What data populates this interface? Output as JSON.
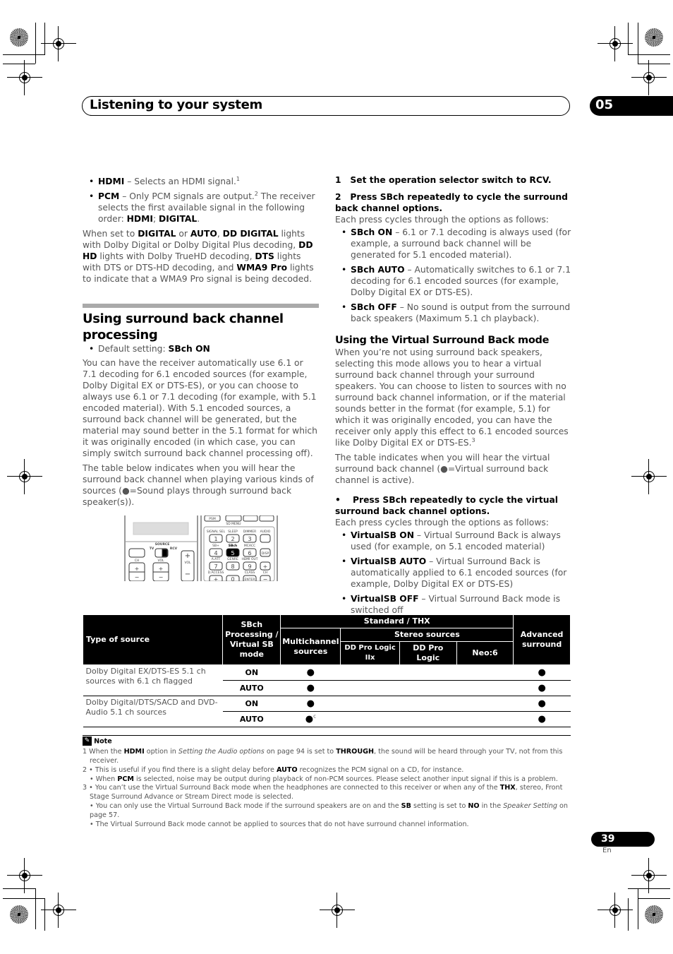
{
  "header": {
    "title": "Listening to your system",
    "chapter": "05"
  },
  "left_column": {
    "bullets": [
      {
        "term": "HDMI",
        "text": " – Selects an HDMI signal.",
        "sup": "1"
      },
      {
        "term": "PCM",
        "text": " – Only PCM signals are output.",
        "sup": "2",
        "text2": " The receiver selects the first available signal in the following order: ",
        "order_a": "HDMI",
        "sep": "; ",
        "order_b": "DIGITAL",
        "end": "."
      }
    ],
    "indicator_para": {
      "t1": "When set to ",
      "b1": "DIGITAL",
      "t2": " or ",
      "b2": "AUTO",
      "t3": ", ",
      "b3": "DD DIGITAL",
      "t4": " lights with Dolby Digital or Dolby Digital Plus decoding, ",
      "b4": "DD HD",
      "t5": " lights with Dolby TrueHD decoding, ",
      "b5": "DTS",
      "t6": " lights with DTS or DTS-HD decoding, and ",
      "b6": "WMA9 Pro",
      "t7": " lights to indicate that a WMA9 Pro signal is being decoded."
    },
    "section_title": "Using surround back channel processing",
    "default_setting_label": "Default setting: ",
    "default_setting_value": "SBch ON",
    "para1": "You can have the receiver automatically use 6.1 or 7.1 decoding for 6.1 encoded sources (for example, Dolby Digital EX or DTS-ES), or you can choose to always use 6.1 or 7.1 decoding (for example, with 5.1 encoded material). With 5.1 encoded sources, a surround back channel will be generated, but the material may sound better in the 5.1 format for which it was originally encoded (in which case, you can simply switch surround back channel processing off).",
    "para2": "The table below indicates when you will hear the surround back channel when playing various kinds of sources (●=Sound plays through surround back speaker(s)).",
    "remote": {
      "source_label": "SOURCE",
      "tv_label": "TV",
      "rcv_label": "RCV",
      "ch_label": "CH",
      "vol_label": "VOL",
      "psm_label": "PSM",
      "menu_label": "SD MENU",
      "row1_labels": [
        "SIGNAL SEL",
        "SLEEP",
        "DIMMER",
        "AUDIO"
      ],
      "row1_keys": [
        "1",
        "2",
        "3",
        ""
      ],
      "row2_labels": [
        "SB+",
        "SBch",
        "MCACC",
        ""
      ],
      "row2_keys": [
        "4",
        "5",
        "6",
        "DISP"
      ],
      "row3_labels": [
        "A.ATT",
        "GENRE",
        "HDMI OUT",
        ""
      ],
      "row3_keys": [
        "7",
        "8",
        "9",
        "+"
      ],
      "row4_labels": [
        "D.ACCESS",
        "",
        "CLASS",
        "CH"
      ],
      "row4_keys": [
        "+",
        "0",
        "ENTER",
        "−"
      ]
    }
  },
  "right_column": {
    "step1_num": "1",
    "step1": "Set the operation selector switch to RCV.",
    "step2_num": "2",
    "step2": "Press SBch repeatedly to cycle the surround back channel options.",
    "cycle_intro": "Each press cycles through the options as follows:",
    "sbch_options": [
      {
        "term": "SBch ON",
        "text": " – 6.1 or 7.1 decoding is always used (for example, a surround back channel will be generated for 5.1 encoded material)."
      },
      {
        "term": "SBch AUTO",
        "text": " – Automatically switches to 6.1 or 7.1 decoding for 6.1 encoded sources (for example, Dolby Digital EX or DTS-ES)."
      },
      {
        "term": "SBch OFF",
        "text": " – No sound is output from the surround back speakers (Maximum 5.1 ch playback)."
      }
    ],
    "virtual_title": "Using the Virtual Surround Back mode",
    "virtual_para1": "When you’re not using surround back speakers, selecting this mode allows you to hear a virtual surround back channel through your surround speakers. You can choose to listen to sources with no surround back channel information, or if the material sounds better in the format (for example, 5.1) for which it was originally encoded, you can have the receiver only apply this effect to 6.1 encoded sources like Dolby Digital EX or DTS-ES.",
    "virtual_para1_sup": "3",
    "virtual_para2": "The table indicates when you will hear the virtual surround back channel (●=Virtual surround back channel is active).",
    "virtual_step": "Press SBch repeatedly to cycle the virtual surround back channel options.",
    "virtual_cycle_intro": "Each press cycles through the options as follows:",
    "virtual_options": [
      {
        "term": "VirtualSB ON",
        "text": " – Virtual Surround Back is always used (for example, on 5.1 encoded material)"
      },
      {
        "term": "VirtualSB AUTO",
        "text": " – Virtual Surround Back is automatically applied to 6.1 encoded sources (for example, Dolby Digital EX or DTS-ES)"
      },
      {
        "term": "VirtualSB OFF",
        "text": " – Virtual Surround Back mode is switched off"
      }
    ]
  },
  "table": {
    "headers": {
      "type_of_source": "Type of source",
      "sbch_mode": "SBch Processing / Virtual SB mode",
      "standard_thx": "Standard / THX",
      "multichannel": "Multichannel sources",
      "stereo_sources": "Stereo sources",
      "pl2x": "DD Pro Logic IIx",
      "pl": "DD Pro Logic",
      "neo6": "Neo:6",
      "advanced": "Advanced surround"
    },
    "groups": [
      {
        "source": "Dolby Digital EX/DTS-ES 5.1 ch sources with 6.1 ch flagged",
        "rows": [
          {
            "mode": "ON",
            "multichannel": "●",
            "multichannel_sup": "",
            "pl2x": "",
            "pl": "",
            "neo6": "",
            "advanced": "●"
          },
          {
            "mode": "AUTO",
            "multichannel": "●",
            "multichannel_sup": "",
            "pl2x": "",
            "pl": "",
            "neo6": "",
            "advanced": "●"
          }
        ]
      },
      {
        "source": "Dolby Digital/DTS/SACD and DVD-Audio 5.1 ch sources",
        "rows": [
          {
            "mode": "ON",
            "multichannel": "●",
            "multichannel_sup": "",
            "pl2x": "",
            "pl": "",
            "neo6": "",
            "advanced": "●"
          },
          {
            "mode": "AUTO",
            "multichannel": "●",
            "multichannel_sup": "c",
            "pl2x": "",
            "pl": "",
            "neo6": "",
            "advanced": "●"
          }
        ]
      }
    ]
  },
  "notes": {
    "title": "Note",
    "n1": {
      "num": "1",
      "t1": " When the ",
      "b1": "HDMI",
      "t2": " option in ",
      "i1": "Setting the Audio options",
      "t3": " on page 94 is set to ",
      "b2": "THROUGH",
      "t4": ", the sound will be heard through your TV, not from this receiver."
    },
    "n2a": {
      "num": "2",
      "t1": " • This is useful if you find there is a slight delay before ",
      "b1": "AUTO",
      "t2": " recognizes the PCM signal on a CD, for instance."
    },
    "n2b": {
      "t1": "• When ",
      "b1": "PCM",
      "t2": " is selected, noise may be output during playback of non-PCM sources. Please select another input signal if this is a problem."
    },
    "n3a": {
      "num": "3",
      "t1": " • You can’t use the Virtual Surround Back mode when the headphones are connected to this receiver or when any of the ",
      "b1": "THX",
      "t2": ", stereo, Front Stage Surround Advance or Stream Direct mode is selected."
    },
    "n3b": {
      "t1": "• You can only use the Virtual Surround Back mode if the surround speakers are on and the ",
      "b1": "SB",
      "t2": " setting is set to ",
      "b2": "NO",
      "t3": " in the ",
      "i1": "Speaker Setting",
      "t4": " on page 57."
    },
    "n3c": {
      "t1": "• The Virtual Surround Back mode cannot be applied to sources that do not have surround channel information."
    }
  },
  "footer": {
    "page_number": "39",
    "language": "En"
  }
}
